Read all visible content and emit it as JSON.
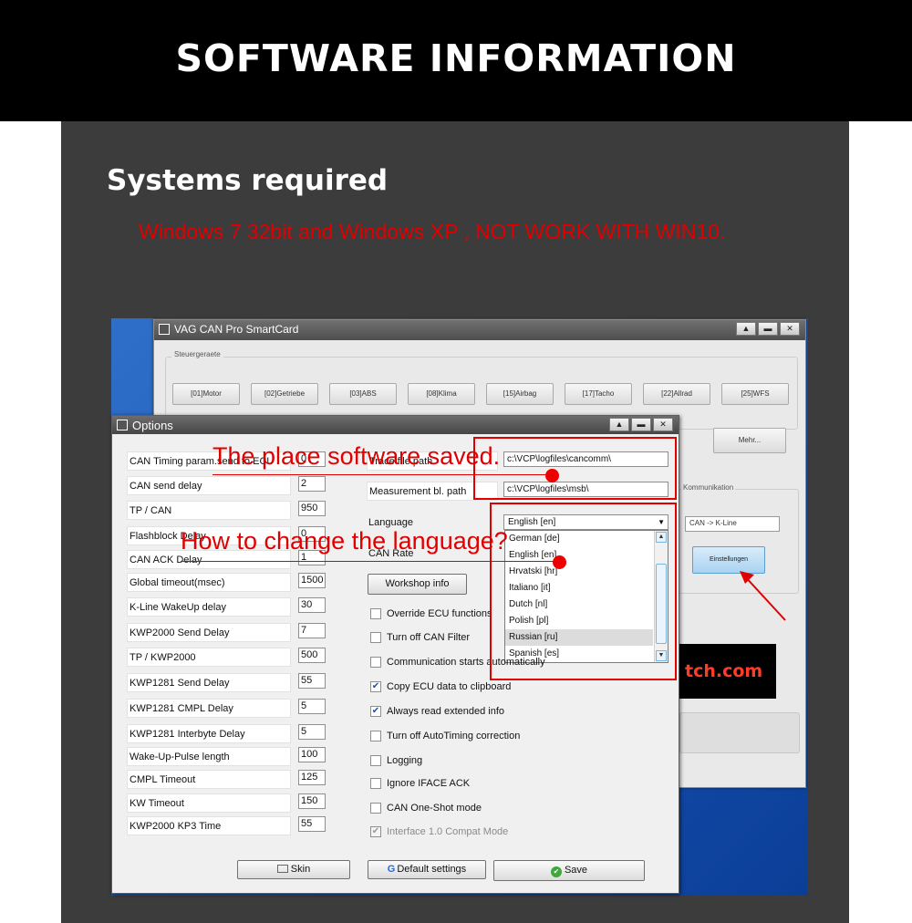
{
  "banner": {
    "title": "SOFTWARE INFORMATION"
  },
  "systems": {
    "heading": "Systems required",
    "note": "Windows 7 32bit and Windows XP , NOT WORK WITH WIN10."
  },
  "main_window": {
    "title": "VAG CAN Pro SmartCard",
    "group_label": "Steuergeraete",
    "ecu_buttons": [
      "[01]Motor",
      "[02]Getriebe",
      "[03]ABS",
      "[08]Klima",
      "[15]Airbag",
      "[17]Tacho",
      "[22]Allrad",
      "[25]WFS"
    ],
    "mehr_label": "Mehr...",
    "comm_group_label": "Kommunikation",
    "comm_select": "CAN -> K-Line",
    "einstellungen_label": "Einstellungen",
    "logo_text": "tch.com"
  },
  "options": {
    "title": "Options",
    "params": [
      {
        "label": "CAN Timing param.send to ECU",
        "value": "0"
      },
      {
        "label": "CAN send delay",
        "value": "2"
      },
      {
        "label": "TP / CAN",
        "value": "950"
      },
      {
        "label": "Flashblock Delay",
        "value": "0"
      },
      {
        "label": "CAN ACK Delay",
        "value": "1"
      },
      {
        "label": "Global timeout(msec)",
        "value": "1500"
      },
      {
        "label": "K-Line WakeUp delay",
        "value": "30"
      },
      {
        "label": "KWP2000 Send Delay",
        "value": "7"
      },
      {
        "label": "TP / KWP2000",
        "value": "500"
      },
      {
        "label": "KWP1281 Send Delay",
        "value": "55"
      },
      {
        "label": "KWP1281 CMPL Delay",
        "value": "5"
      },
      {
        "label": "KWP1281 Interbyte Delay",
        "value": "5"
      },
      {
        "label": "Wake-Up-Pulse length",
        "value": "100"
      },
      {
        "label": "CMPL Timeout",
        "value": "125"
      },
      {
        "label": "KW Timeout",
        "value": "150"
      },
      {
        "label": "KWP2000 KP3 Time",
        "value": "55"
      }
    ],
    "trace_label": "Trace file path",
    "trace_value": "c:\\VCP\\logfiles\\cancomm\\",
    "measure_label": "Measurement bl. path",
    "measure_value": "c:\\VCP\\logfiles\\msb\\",
    "language_label": "Language",
    "language_value": "English [en]",
    "language_options": [
      "German [de]",
      "English [en]",
      "Hrvatski [hr]",
      "Italiano [it]",
      "Dutch [nl]",
      "Polish [pl]",
      "Russian [ru]",
      "Spanish [es]"
    ],
    "can_rate_label": "CAN Rate",
    "workshop_button": "Workshop info",
    "checkboxes": [
      {
        "label": "Override ECU functions",
        "checked": false
      },
      {
        "label": "Turn off CAN Filter",
        "checked": false
      },
      {
        "label": "Communication starts automatically",
        "checked": false
      },
      {
        "label": "Copy ECU data to clipboard",
        "checked": true
      },
      {
        "label": "Always read extended info",
        "checked": true
      },
      {
        "label": "Turn off AutoTiming correction",
        "checked": false
      },
      {
        "label": "Logging",
        "checked": false
      },
      {
        "label": "Ignore IFACE ACK",
        "checked": false
      },
      {
        "label": "CAN One-Shot mode",
        "checked": false
      },
      {
        "label": "Interface 1.0 Compat Mode",
        "checked": true
      }
    ],
    "skin_button": "Skin",
    "default_button": "Default settings",
    "save_button": "Save"
  },
  "annotations": {
    "saved": "The place software saved.",
    "language": "How to change the language?"
  },
  "colors": {
    "accent_red": "#e00000",
    "panel": "#3c3c3c",
    "banner": "#000000"
  }
}
